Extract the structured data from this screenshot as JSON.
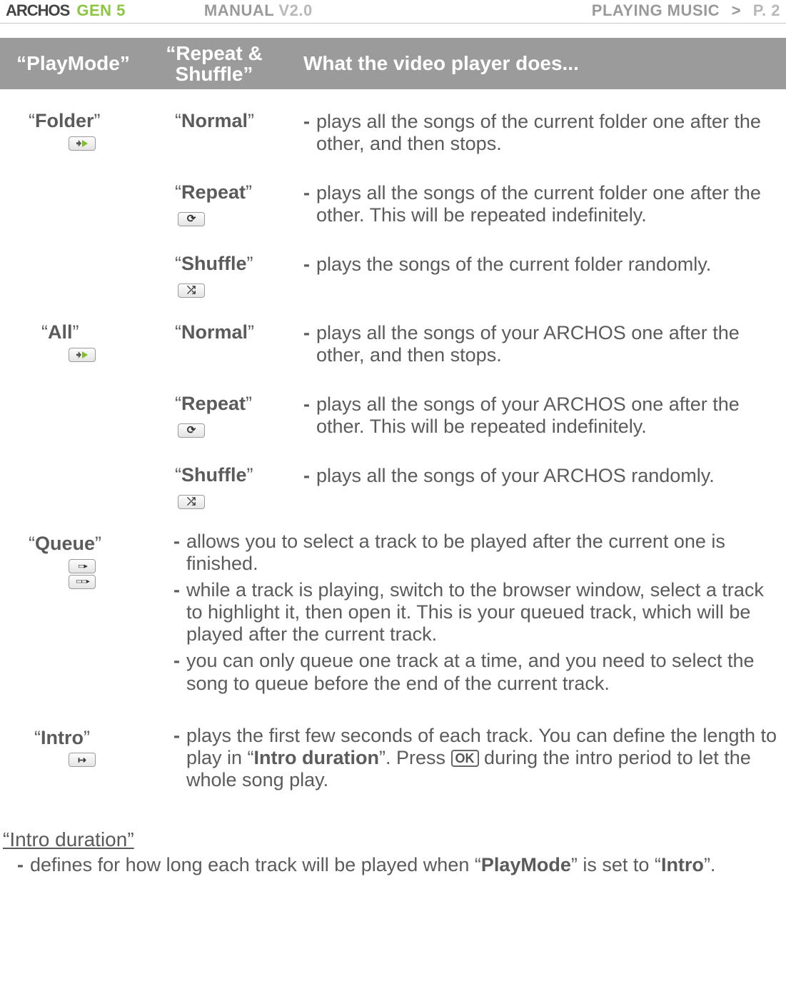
{
  "header": {
    "logo": "ARCHOS",
    "gen": "GEN 5",
    "manual": "MANUAL",
    "version": "V2.0",
    "section": "PLAYING MUSIC",
    "sep": ">",
    "page": "P. 2"
  },
  "thead": {
    "c1": "“PlayMode”",
    "c2": "“Repeat & Shuffle”",
    "c3": "What the video player does..."
  },
  "rows": [
    {
      "mode": "Folder",
      "mode_icon": "playmode-folder-icon",
      "subs": [
        {
          "label": "Normal",
          "icon": null,
          "bullets": [
            "plays all the songs of the current folder one after the other, and then stops."
          ]
        },
        {
          "label": "Repeat",
          "icon": "loop",
          "bullets": [
            "plays all the songs of the current folder one after the other. This will be repeated indefinitely."
          ]
        },
        {
          "label": "Shuffle",
          "icon": "shuf",
          "bullets": [
            "plays the songs of the current folder randomly."
          ]
        }
      ]
    },
    {
      "mode": "All",
      "mode_icon": "playmode-all-icon",
      "subs": [
        {
          "label": "Normal",
          "icon": null,
          "bullets": [
            "plays all the songs of your ARCHOS one after the other, and then stops."
          ]
        },
        {
          "label": "Repeat",
          "icon": "loop",
          "bullets": [
            "plays all the songs of your ARCHOS one after the other. This will be repeated indefinitely."
          ]
        },
        {
          "label": "Shuffle",
          "icon": "shuf",
          "bullets": [
            "plays all the songs of your ARCHOS randomly."
          ]
        }
      ]
    },
    {
      "mode": "Queue",
      "mode_icon": "playmode-queue-icon",
      "wide": true,
      "bullets": [
        "allows you to select a track to be played after the current one is finished.",
        "while a track is playing, switch to the browser window, select a track to highlight it, then open it. This is your queued track, which will be played after the current track.",
        "you can only queue one track at a time, and you need to select the song to queue before the end of the current track."
      ]
    },
    {
      "mode": "Intro",
      "mode_icon": "playmode-intro-icon",
      "wide": true,
      "bullets_rich": [
        {
          "pre": "plays the first few seconds of each track. You can define the length to play in “",
          "bold1": "Intro duration",
          "mid": "”. Press ",
          "ok": "OK",
          "post": " during the intro period to let the whole song play."
        }
      ]
    }
  ],
  "intro_section": {
    "heading": "“Intro duration”",
    "bullet_pre": "defines for how long each track will be played when “",
    "bullet_b1": "PlayMode",
    "bullet_mid": "” is set to “",
    "bullet_b2": "Intro",
    "bullet_post": "”."
  }
}
